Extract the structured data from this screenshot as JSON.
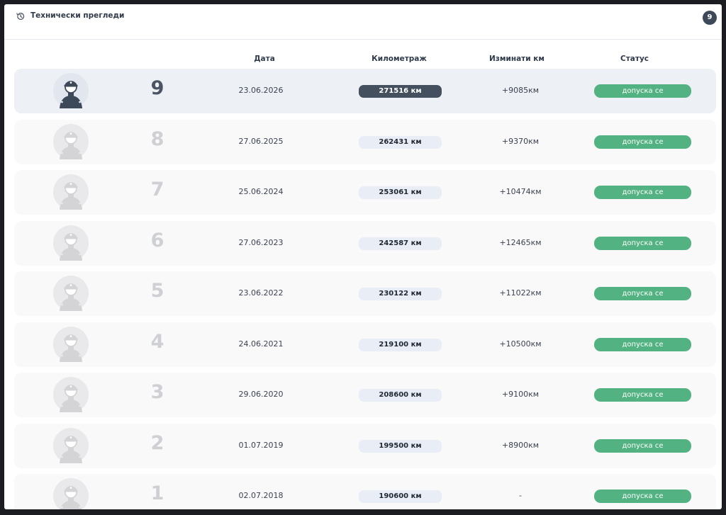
{
  "header": {
    "title": "Технически прегледи",
    "count": "9"
  },
  "columns": {
    "date": "Дата",
    "mileage": "Километраж",
    "delta": "Изминати км",
    "status": "Статус"
  },
  "rows": [
    {
      "num": "9",
      "date": "23.06.2026",
      "km": "271516 км",
      "delta": "+9085км",
      "status": "допуска се",
      "active": true
    },
    {
      "num": "8",
      "date": "27.06.2025",
      "km": "262431 км",
      "delta": "+9370км",
      "status": "допуска се"
    },
    {
      "num": "7",
      "date": "25.06.2024",
      "km": "253061 км",
      "delta": "+10474км",
      "status": "допуска се"
    },
    {
      "num": "6",
      "date": "27.06.2023",
      "km": "242587 км",
      "delta": "+12465км",
      "status": "допуска се"
    },
    {
      "num": "5",
      "date": "23.06.2022",
      "km": "230122 км",
      "delta": "+11022км",
      "status": "допуска се"
    },
    {
      "num": "4",
      "date": "24.06.2021",
      "km": "219100 км",
      "delta": "+10500км",
      "status": "допуска се"
    },
    {
      "num": "3",
      "date": "29.06.2020",
      "km": "208600 км",
      "delta": "+9100км",
      "status": "допуска се"
    },
    {
      "num": "2",
      "date": "01.07.2019",
      "km": "199500 км",
      "delta": "+8900км",
      "status": "допуска се"
    },
    {
      "num": "1",
      "date": "02.07.2018",
      "km": "190600 км",
      "delta": "-",
      "status": "допуска се"
    }
  ],
  "colors": {
    "status_ok": "#52b282",
    "active_km_bg": "#45505f",
    "badge_bg": "#3d4859"
  },
  "icons": {
    "history": "history-icon",
    "avatar": "mechanic-avatar-icon"
  }
}
